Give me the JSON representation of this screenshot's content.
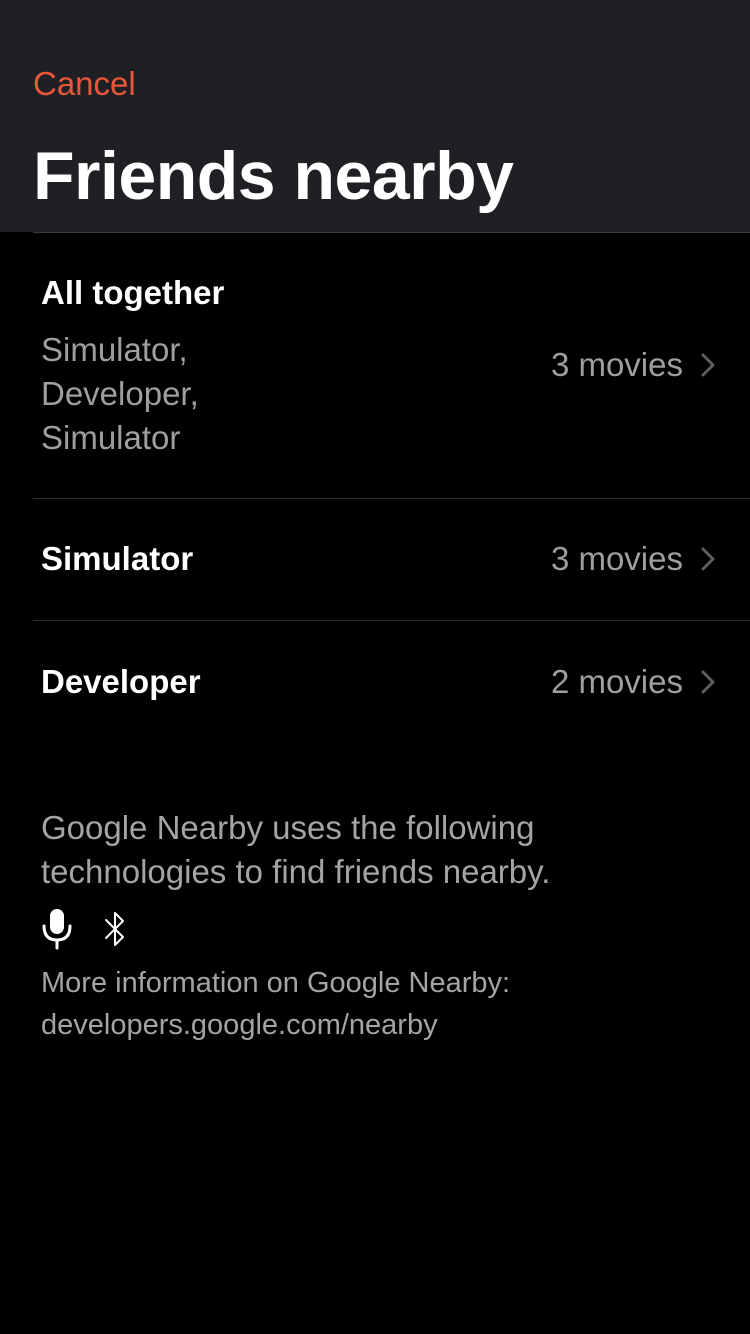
{
  "header": {
    "cancel_label": "Cancel",
    "title": "Friends nearby"
  },
  "rows": [
    {
      "title": "All together",
      "members": "Simulator,\nDeveloper,\nSimulator",
      "count": "3 movies"
    },
    {
      "title": "Simulator",
      "count": "3 movies"
    },
    {
      "title": "Developer",
      "count": "2 movies"
    }
  ],
  "footer": {
    "info_text": "Google Nearby uses the following technologies to find friends nearby.",
    "icons": [
      "microphone-icon",
      "bluetooth-icon"
    ],
    "more_info_label": "More information on Google Nearby:",
    "more_info_link": "developers.google.com/nearby"
  },
  "colors": {
    "accent": "#e8573a",
    "header_background": "#1f2024",
    "background": "#000000",
    "secondary_text": "#9e9ea3"
  }
}
